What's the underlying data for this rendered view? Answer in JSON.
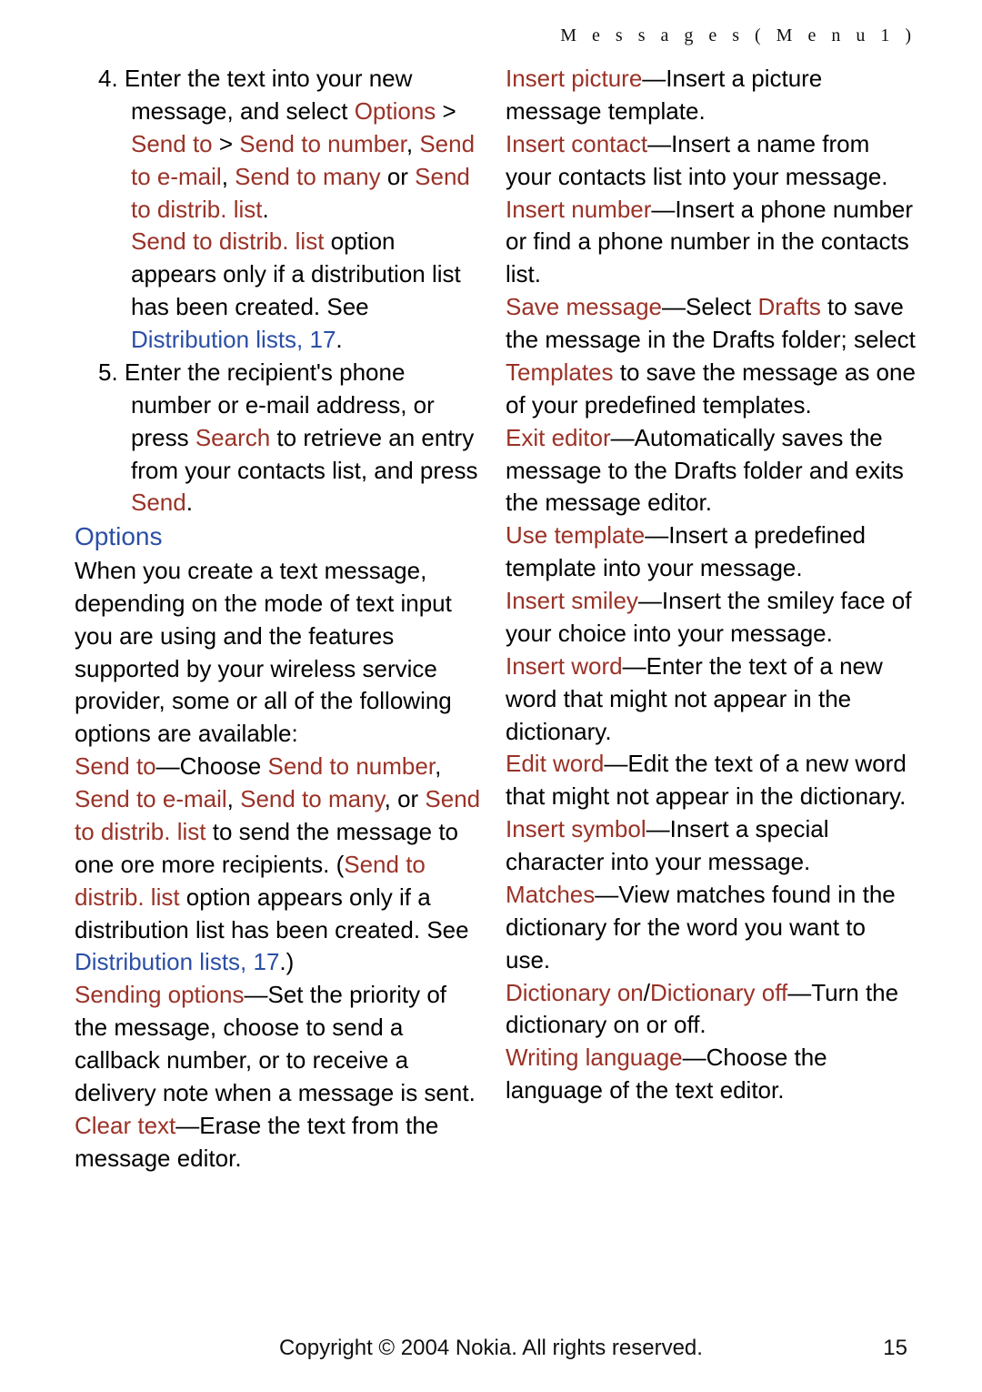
{
  "running_head": "M e s s a g e s   ( M e n u   1 )",
  "step4": {
    "num": "4.",
    "a": " Enter the text into your new message, and select ",
    "b": "Options",
    "c": " > ",
    "d": "Send to",
    "e": " > ",
    "f": "Send to number",
    "g": ", ",
    "h": "Send to e-mail",
    "i": ", ",
    "j": "Send to many",
    "k": " or ",
    "l": "Send to distrib. list",
    "m": "."
  },
  "step4_note": {
    "a": "Send to distrib. list",
    "b": " option appears only if a distribution list has been created. See ",
    "c": "Distribution lists, 17",
    "d": "."
  },
  "step5": {
    "num": "5.",
    "a": " Enter the recipient's phone number or e-mail address, or press ",
    "b": "Search",
    "c": " to retrieve an entry from your contacts list, and press ",
    "d": "Send",
    "e": "."
  },
  "options_header": "Options",
  "options_intro": "When you create a text message, depending on the mode of text input you are using and the features supported by your wireless service provider, some or all of the following options are available:",
  "opt_send_to": {
    "a": "Send to",
    "b": "—Choose ",
    "c": "Send to number",
    "d": ", ",
    "e": "Send to e-mail",
    "f": ", ",
    "g": "Send to many",
    "h": ", or ",
    "i": "Send to distrib. list",
    "j": " to send the message to one ore more recipients. (",
    "k": "Send to distrib. list",
    "l": " option appears only if a distribution list has been created. See ",
    "m": "Distribution lists, 17",
    "n": ".)"
  },
  "opt_sending": {
    "a": "Sending options",
    "b": "—Set the priority of the message, choose to send a callback number, or to receive a delivery note when a message is sent."
  },
  "opt_clear": {
    "a": "Clear text",
    "b": "—Erase the text from the message editor."
  },
  "opt_picture": {
    "a": "Insert picture",
    "b": "—Insert a picture message template."
  },
  "opt_contact": {
    "a": "Insert contact",
    "b": "—Insert a name from your contacts list into your message."
  },
  "opt_number": {
    "a": "Insert number",
    "b": "—Insert a phone number or find a phone number in the contacts list."
  },
  "opt_save": {
    "a": "Save message",
    "b": "—Select ",
    "c": "Drafts",
    "d": " to save the message in the Drafts folder; select ",
    "e": "Templates",
    "f": " to save the message as one of your predefined templates."
  },
  "opt_exit": {
    "a": "Exit editor",
    "b": "—Automatically saves the message to the Drafts folder and exits the message editor."
  },
  "opt_usetpl": {
    "a": "Use template",
    "b": "—Insert a predefined template into your message."
  },
  "opt_smiley": {
    "a": "Insert smiley",
    "b": "—Insert the smiley face of your choice into your message."
  },
  "opt_word": {
    "a": "Insert word",
    "b": "—Enter the text of a new word that might not appear in the dictionary."
  },
  "opt_editword": {
    "a": "Edit word",
    "b": "—Edit the text of a new word that might not appear in the dictionary."
  },
  "opt_symbol": {
    "a": "Insert symbol",
    "b": "—Insert a special character into your message."
  },
  "opt_matches": {
    "a": "Matches",
    "b": "—View matches found in the dictionary for the word you want to use."
  },
  "opt_dict": {
    "a": "Dictionary on",
    "b": "/",
    "c": "Dictionary off",
    "d": "—Turn the dictionary on or off."
  },
  "opt_lang": {
    "a": "Writing language",
    "b": "—Choose the language of the text editor."
  },
  "footer": "Copyright © 2004 Nokia. All rights reserved.",
  "page_number": "15"
}
